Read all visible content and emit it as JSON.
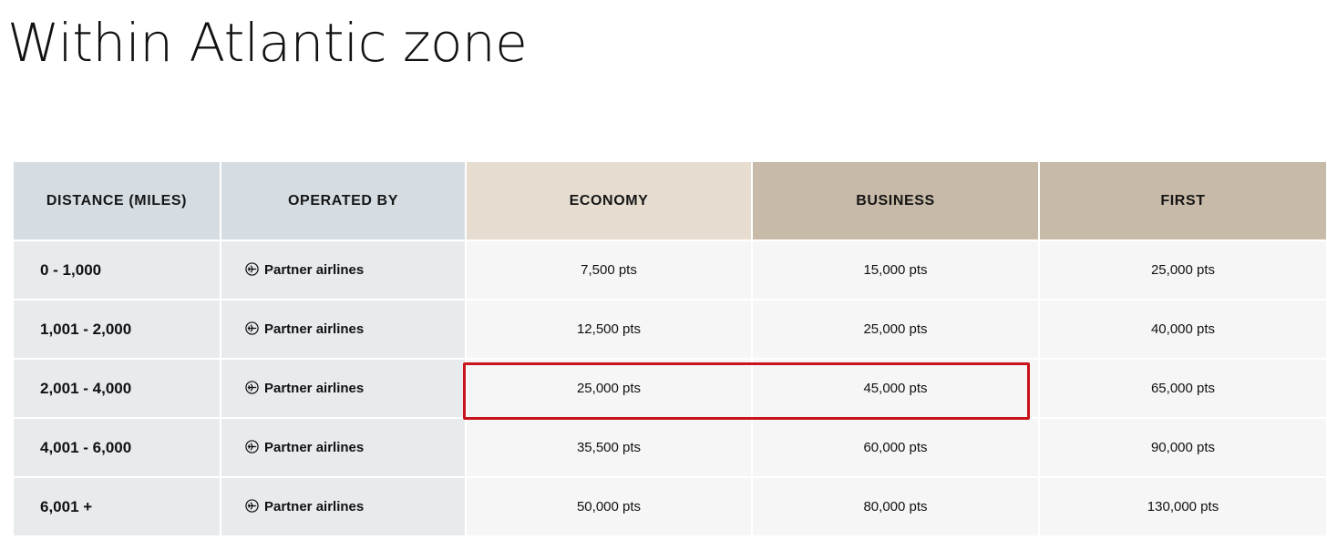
{
  "page": {
    "title": "Within Atlantic zone"
  },
  "colors": {
    "header_meta_bg": "#d5dde3",
    "header_economy_bg": "#e6ddd0",
    "header_premium_bg": "#c8baa8",
    "row_label_bg": "#e8ebed",
    "row_value_bg": "#f6f6f6",
    "highlight": "#c8141c"
  },
  "table": {
    "headers": {
      "distance": "DISTANCE (MILES)",
      "operated_by": "OPERATED BY",
      "economy": "ECONOMY",
      "business": "BUSINESS",
      "first": "FIRST"
    },
    "operator_icon": "plane-circle-icon",
    "rows": [
      {
        "distance": "0 - 1,000",
        "operated_by": "Partner airlines",
        "economy": "7,500 pts",
        "business": "15,000 pts",
        "first": "25,000 pts"
      },
      {
        "distance": "1,001 - 2,000",
        "operated_by": "Partner airlines",
        "economy": "12,500 pts",
        "business": "25,000 pts",
        "first": "40,000 pts"
      },
      {
        "distance": "2,001 - 4,000",
        "operated_by": "Partner airlines",
        "economy": "25,000 pts",
        "business": "45,000 pts",
        "first": "65,000 pts"
      },
      {
        "distance": "4,001 - 6,000",
        "operated_by": "Partner airlines",
        "economy": "35,500 pts",
        "business": "60,000 pts",
        "first": "90,000 pts"
      },
      {
        "distance": "6,001 +",
        "operated_by": "Partner airlines",
        "economy": "50,000 pts",
        "business": "80,000 pts",
        "first": "130,000 pts"
      }
    ],
    "highlighted_row": 2,
    "highlighted_columns": [
      "economy",
      "business"
    ]
  }
}
